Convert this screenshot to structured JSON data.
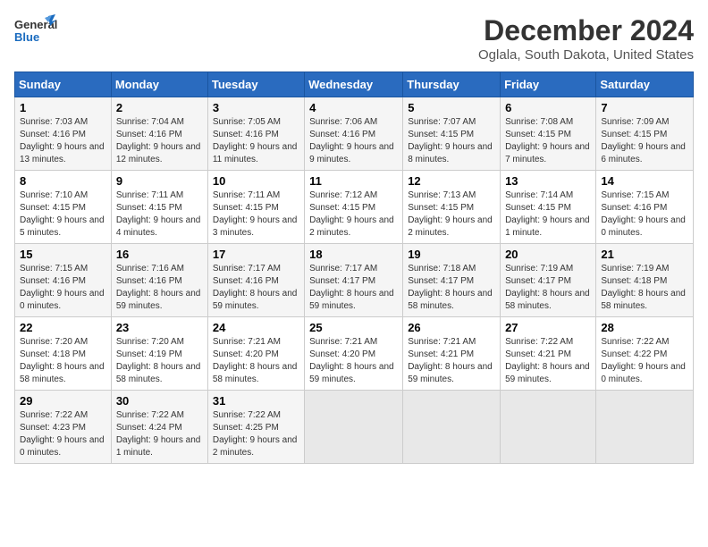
{
  "logo": {
    "line1": "General",
    "line2": "Blue"
  },
  "title": "December 2024",
  "subtitle": "Oglala, South Dakota, United States",
  "days_of_week": [
    "Sunday",
    "Monday",
    "Tuesday",
    "Wednesday",
    "Thursday",
    "Friday",
    "Saturday"
  ],
  "weeks": [
    [
      {
        "day": "1",
        "sunrise": "7:03 AM",
        "sunset": "4:16 PM",
        "daylight": "9 hours and 13 minutes."
      },
      {
        "day": "2",
        "sunrise": "7:04 AM",
        "sunset": "4:16 PM",
        "daylight": "9 hours and 12 minutes."
      },
      {
        "day": "3",
        "sunrise": "7:05 AM",
        "sunset": "4:16 PM",
        "daylight": "9 hours and 11 minutes."
      },
      {
        "day": "4",
        "sunrise": "7:06 AM",
        "sunset": "4:16 PM",
        "daylight": "9 hours and 9 minutes."
      },
      {
        "day": "5",
        "sunrise": "7:07 AM",
        "sunset": "4:15 PM",
        "daylight": "9 hours and 8 minutes."
      },
      {
        "day": "6",
        "sunrise": "7:08 AM",
        "sunset": "4:15 PM",
        "daylight": "9 hours and 7 minutes."
      },
      {
        "day": "7",
        "sunrise": "7:09 AM",
        "sunset": "4:15 PM",
        "daylight": "9 hours and 6 minutes."
      }
    ],
    [
      {
        "day": "8",
        "sunrise": "7:10 AM",
        "sunset": "4:15 PM",
        "daylight": "9 hours and 5 minutes."
      },
      {
        "day": "9",
        "sunrise": "7:11 AM",
        "sunset": "4:15 PM",
        "daylight": "9 hours and 4 minutes."
      },
      {
        "day": "10",
        "sunrise": "7:11 AM",
        "sunset": "4:15 PM",
        "daylight": "9 hours and 3 minutes."
      },
      {
        "day": "11",
        "sunrise": "7:12 AM",
        "sunset": "4:15 PM",
        "daylight": "9 hours and 2 minutes."
      },
      {
        "day": "12",
        "sunrise": "7:13 AM",
        "sunset": "4:15 PM",
        "daylight": "9 hours and 2 minutes."
      },
      {
        "day": "13",
        "sunrise": "7:14 AM",
        "sunset": "4:15 PM",
        "daylight": "9 hours and 1 minute."
      },
      {
        "day": "14",
        "sunrise": "7:15 AM",
        "sunset": "4:16 PM",
        "daylight": "9 hours and 0 minutes."
      }
    ],
    [
      {
        "day": "15",
        "sunrise": "7:15 AM",
        "sunset": "4:16 PM",
        "daylight": "9 hours and 0 minutes."
      },
      {
        "day": "16",
        "sunrise": "7:16 AM",
        "sunset": "4:16 PM",
        "daylight": "8 hours and 59 minutes."
      },
      {
        "day": "17",
        "sunrise": "7:17 AM",
        "sunset": "4:16 PM",
        "daylight": "8 hours and 59 minutes."
      },
      {
        "day": "18",
        "sunrise": "7:17 AM",
        "sunset": "4:17 PM",
        "daylight": "8 hours and 59 minutes."
      },
      {
        "day": "19",
        "sunrise": "7:18 AM",
        "sunset": "4:17 PM",
        "daylight": "8 hours and 58 minutes."
      },
      {
        "day": "20",
        "sunrise": "7:19 AM",
        "sunset": "4:17 PM",
        "daylight": "8 hours and 58 minutes."
      },
      {
        "day": "21",
        "sunrise": "7:19 AM",
        "sunset": "4:18 PM",
        "daylight": "8 hours and 58 minutes."
      }
    ],
    [
      {
        "day": "22",
        "sunrise": "7:20 AM",
        "sunset": "4:18 PM",
        "daylight": "8 hours and 58 minutes."
      },
      {
        "day": "23",
        "sunrise": "7:20 AM",
        "sunset": "4:19 PM",
        "daylight": "8 hours and 58 minutes."
      },
      {
        "day": "24",
        "sunrise": "7:21 AM",
        "sunset": "4:20 PM",
        "daylight": "8 hours and 58 minutes."
      },
      {
        "day": "25",
        "sunrise": "7:21 AM",
        "sunset": "4:20 PM",
        "daylight": "8 hours and 59 minutes."
      },
      {
        "day": "26",
        "sunrise": "7:21 AM",
        "sunset": "4:21 PM",
        "daylight": "8 hours and 59 minutes."
      },
      {
        "day": "27",
        "sunrise": "7:22 AM",
        "sunset": "4:21 PM",
        "daylight": "8 hours and 59 minutes."
      },
      {
        "day": "28",
        "sunrise": "7:22 AM",
        "sunset": "4:22 PM",
        "daylight": "9 hours and 0 minutes."
      }
    ],
    [
      {
        "day": "29",
        "sunrise": "7:22 AM",
        "sunset": "4:23 PM",
        "daylight": "9 hours and 0 minutes."
      },
      {
        "day": "30",
        "sunrise": "7:22 AM",
        "sunset": "4:24 PM",
        "daylight": "9 hours and 1 minute."
      },
      {
        "day": "31",
        "sunrise": "7:22 AM",
        "sunset": "4:25 PM",
        "daylight": "9 hours and 2 minutes."
      },
      null,
      null,
      null,
      null
    ]
  ],
  "labels": {
    "sunrise": "Sunrise:",
    "sunset": "Sunset:",
    "daylight": "Daylight:"
  }
}
